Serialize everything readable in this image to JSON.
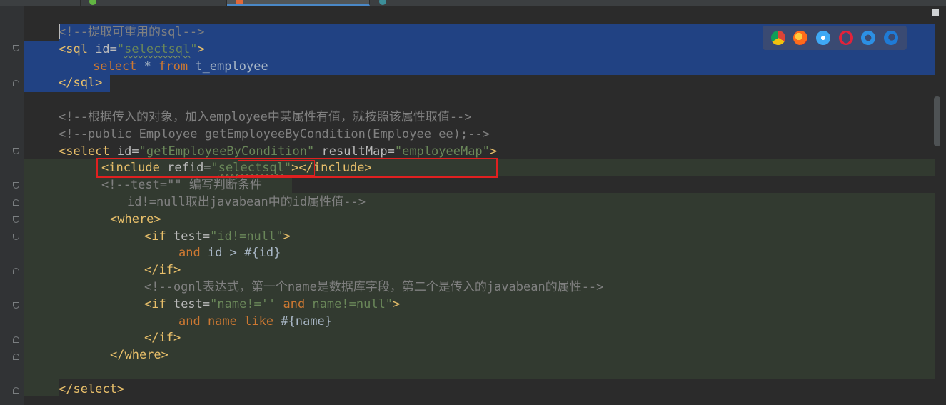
{
  "editor": {
    "lines": [
      {
        "parts": [
          {
            "c": "cm",
            "t": "<!--提取可重用的sql-->"
          }
        ]
      },
      {
        "parts": [
          {
            "c": "tag",
            "t": "<sql "
          },
          {
            "c": "attr",
            "t": "id="
          },
          {
            "c": "val",
            "t": "\""
          },
          {
            "c": "val squig",
            "t": "selectsql"
          },
          {
            "c": "val",
            "t": "\""
          },
          {
            "c": "tag",
            "t": ">"
          }
        ]
      },
      {
        "parts": [
          {
            "c": "kw",
            "t": "select"
          },
          {
            "c": "txt",
            "t": " * "
          },
          {
            "c": "kw",
            "t": "from"
          },
          {
            "c": "txt",
            "t": " t_employee"
          }
        ]
      },
      {
        "parts": [
          {
            "c": "tag",
            "t": "</sql>"
          }
        ]
      },
      {
        "parts": []
      },
      {
        "parts": [
          {
            "c": "cm",
            "t": "<!--根据传入的对象，加入employee中某属性有值，就按照该属性取值-->"
          }
        ]
      },
      {
        "parts": [
          {
            "c": "cm",
            "t": "<!--public Employee getEmployeeByCondition(Employee ee);-->"
          }
        ]
      },
      {
        "parts": [
          {
            "c": "tag",
            "t": "<select "
          },
          {
            "c": "attr",
            "t": "id="
          },
          {
            "c": "val",
            "t": "\"getEmployeeByCondition\""
          },
          {
            "c": "attr",
            "t": " resultMap="
          },
          {
            "c": "val",
            "t": "\"employeeMap\""
          },
          {
            "c": "tag",
            "t": ">"
          }
        ]
      },
      {
        "parts": [
          {
            "c": "tag",
            "t": "<include "
          },
          {
            "c": "attr",
            "t": "refid="
          },
          {
            "c": "val",
            "t": "\""
          },
          {
            "c": "val squig",
            "t": "selectsql"
          },
          {
            "c": "val",
            "t": "\""
          },
          {
            "c": "tag",
            "t": "></include>"
          }
        ]
      },
      {
        "parts": [
          {
            "c": "cm",
            "t": "<!--test=\"\" 编写判断条件"
          }
        ]
      },
      {
        "parts": [
          {
            "c": "cm",
            "t": "id!=null取出javabean中的id属性值-->"
          }
        ]
      },
      {
        "parts": [
          {
            "c": "tag",
            "t": "<where>"
          }
        ]
      },
      {
        "parts": [
          {
            "c": "tag",
            "t": "<if "
          },
          {
            "c": "attr",
            "t": "test="
          },
          {
            "c": "val",
            "t": "\"id!=null\""
          },
          {
            "c": "tag",
            "t": ">"
          }
        ]
      },
      {
        "parts": [
          {
            "c": "kw",
            "t": "and"
          },
          {
            "c": "txt",
            "t": " id > #{id}"
          }
        ]
      },
      {
        "parts": [
          {
            "c": "tag",
            "t": "</if>"
          }
        ]
      },
      {
        "parts": [
          {
            "c": "cm",
            "t": "<!--ognl表达式，第一个name是数据库字段，第二个是传入的javabean的属性-->"
          }
        ]
      },
      {
        "parts": [
          {
            "c": "tag",
            "t": "<if "
          },
          {
            "c": "attr",
            "t": "test="
          },
          {
            "c": "val",
            "t": "\"name!='' "
          },
          {
            "c": "kw",
            "t": "and"
          },
          {
            "c": "val",
            "t": " name!=null\""
          },
          {
            "c": "tag",
            "t": ">"
          }
        ]
      },
      {
        "parts": [
          {
            "c": "kw",
            "t": "and"
          },
          {
            "c": "txt",
            "t": " "
          },
          {
            "c": "kw",
            "t": "name"
          },
          {
            "c": "txt",
            "t": " "
          },
          {
            "c": "kw",
            "t": "like"
          },
          {
            "c": "txt",
            "t": " #{name}"
          }
        ]
      },
      {
        "parts": [
          {
            "c": "tag",
            "t": "</if>"
          }
        ]
      },
      {
        "parts": [
          {
            "c": "tag",
            "t": "</where>"
          }
        ]
      },
      {
        "parts": []
      },
      {
        "parts": [
          {
            "c": "tag",
            "t": "</select>"
          }
        ]
      }
    ]
  },
  "browser_icons": [
    "chrome-icon",
    "firefox-icon",
    "safari-icon",
    "opera-icon",
    "ie-icon",
    "edge-icon"
  ],
  "colors": {
    "selection": "#214283",
    "highlight_box": "#e02020",
    "tag": "#e8bf6a",
    "string": "#6a8759",
    "keyword": "#cc7832",
    "comment": "#808080"
  }
}
